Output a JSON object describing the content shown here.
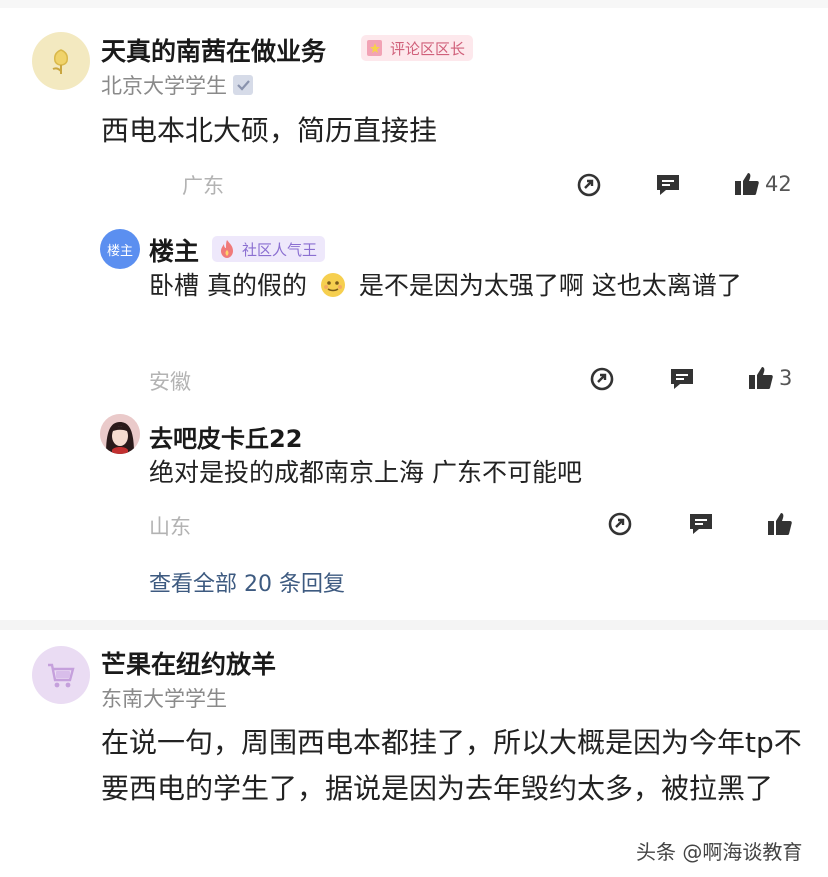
{
  "comment1": {
    "author": "天真的南茜在做业务",
    "badge": "评论区区长",
    "school": "北京大学学生",
    "text": "西电本北大硕，简历直接挂",
    "location": "广东",
    "likes": "42",
    "replies": [
      {
        "author": "楼主",
        "avatar_label": "楼主",
        "badge": "社区人气王",
        "text_before_emoji": "卧槽 真的假的",
        "text_after_emoji": "是不是因为太强了啊 这也太离谱了",
        "location": "安徽",
        "likes": "3"
      },
      {
        "author": "去吧皮卡丘22",
        "text": "绝对是投的成都南京上海 广东不可能吧",
        "location": "山东",
        "likes": ""
      }
    ],
    "view_all": "查看全部 20 条回复"
  },
  "comment2": {
    "author": "芒果在纽约放羊",
    "school": "东南大学学生",
    "text": "在说一句，周围西电本都挂了，所以大概是因为今年tp不要西电的学生了，据说是因为去年毁约太多，被拉黑了"
  },
  "watermark": "头条 @啊海谈教育",
  "colors": {
    "link": "#3d5a80",
    "badge_pink_bg": "#fde8ec",
    "badge_pink_text": "#d0607a",
    "badge_purple_bg": "#eee8fb",
    "badge_purple_text": "#8b6fd1"
  }
}
